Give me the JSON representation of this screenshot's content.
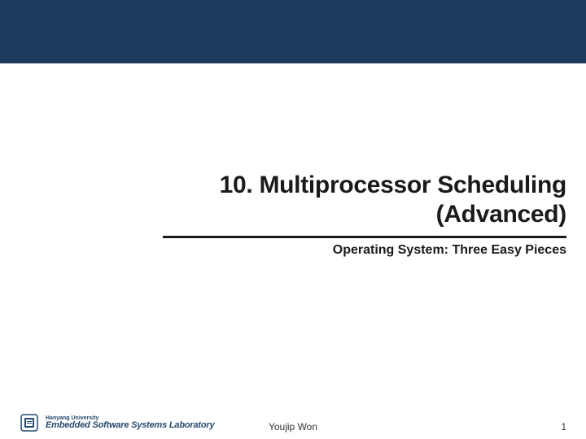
{
  "title_line1": "10. Multiprocessor Scheduling",
  "title_line2": "(Advanced)",
  "subtitle": "Operating System: Three Easy Pieces",
  "footer": {
    "university": "Hanyang University",
    "lab": "Embedded Software Systems Laboratory",
    "author": "Youjip Won",
    "page": "1"
  }
}
